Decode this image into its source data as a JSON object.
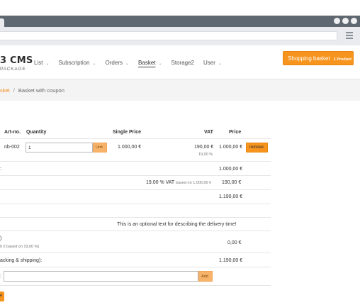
{
  "browser": {
    "menu_icon": "hamburger-icon"
  },
  "header": {
    "logo_main": "3 CMS",
    "logo_sub": "PACKAGE",
    "nav": [
      {
        "label": "List",
        "chevron": "⌄"
      },
      {
        "label": "Subscription",
        "chevron": "⌄"
      },
      {
        "label": "Orders",
        "chevron": "⌄"
      },
      {
        "label": "Basket",
        "chevron": "⌄",
        "active": true
      },
      {
        "label": "Storage2",
        "chevron": ""
      },
      {
        "label": "User",
        "chevron": "⌄"
      }
    ],
    "basket_button": {
      "label": "Shopping basket",
      "count": "1 Product"
    }
  },
  "breadcrumb": {
    "link": "sket",
    "separator": "/",
    "current": "Basket with coupon"
  },
  "table": {
    "headers": {
      "art_no": "Art-no.",
      "quantity": "Quantity",
      "single_price": "Single Price",
      "vat": "VAT",
      "price": "Price"
    },
    "item": {
      "art_no": "nb-002",
      "quantity": "1",
      "unit_label": "Unit",
      "single_price": "1.000,00 €",
      "vat_amount": "190,00 €",
      "vat_rate": "19,00 %",
      "price": "1.000,00 €",
      "remove_label": "remove"
    },
    "subtotal": {
      "label": ":",
      "value": "1.000,00 €"
    },
    "vat_line": {
      "rate": "19,00 % VAT",
      "based_on": "based on 1.000,00 €",
      "value": "190,00 €"
    },
    "total_line": {
      "value": "1.190,00 €"
    },
    "delivery_text": "This is an optional text for describing the delivery time!",
    "shipping": {
      "label": ")",
      "sub": "0 € based on 19,00 %)",
      "value": "0,00 €"
    },
    "grand_total": {
      "label": "acking & shipping):",
      "value": "1.190,00 €"
    },
    "coupon": {
      "label": ":",
      "value": "",
      "add_label": "Add"
    },
    "bottom_button": "e"
  }
}
